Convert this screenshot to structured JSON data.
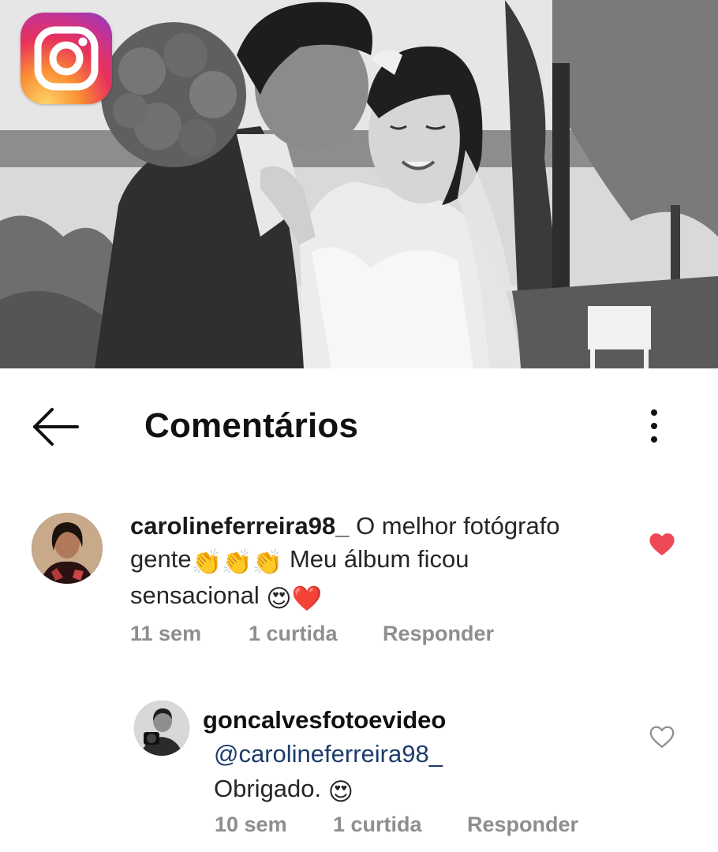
{
  "header": {
    "title": "Comentários"
  },
  "comments": [
    {
      "username": "carolineferreira98_",
      "text_line1": " O melhor fotógrafo",
      "text_line2_a": "gente",
      "clap_emoji": "👏👏👏",
      "text_line2_b": " Meu álbum ficou",
      "text_line3": "sensacional ",
      "emojis": "😍❤️",
      "time": "11 sem",
      "likes": "1 curtida",
      "reply_label": "Responder",
      "liked": true,
      "like_color": "#ed4956"
    },
    {
      "username": "goncalvesfotoevideo",
      "mention": "@carolineferreira98_",
      "text": "Obrigado. ",
      "emoji": "😍",
      "time": "10 sem",
      "likes": "1 curtida",
      "reply_label": "Responder",
      "liked": false
    }
  ],
  "icons": {
    "app_logo": "instagram-logo",
    "back": "arrow-left-icon",
    "more": "more-vertical-icon",
    "liked": "heart-filled-icon",
    "not_liked": "heart-outline-icon"
  }
}
